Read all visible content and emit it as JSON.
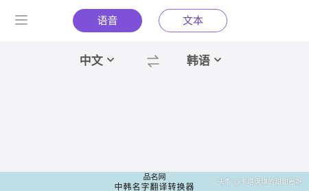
{
  "header": {
    "menu_icon": "hamburger-menu-icon",
    "tabs": [
      {
        "label": "语音",
        "active": true
      },
      {
        "label": "文本",
        "active": false
      }
    ]
  },
  "language_bar": {
    "source_language": "中文",
    "target_language": "韩语",
    "swap_icon": "swap-arrows-icon",
    "dropdown_icon": "chevron-down-icon"
  },
  "footer": {
    "line1": "品名网",
    "line2": "中韩名字翻译转换器"
  },
  "watermark": "头条 @卡塔席琪的甜甜圈呀",
  "colors": {
    "accent": "#7d52d8",
    "content_background": "#f4f4f6",
    "footer_background": "#bfdfe6"
  }
}
